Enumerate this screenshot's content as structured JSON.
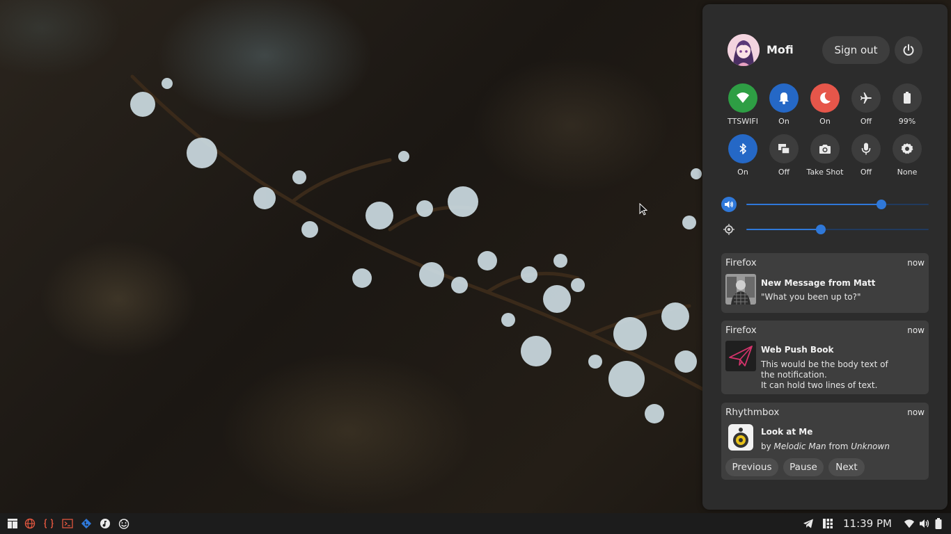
{
  "user": {
    "name": "Mofi"
  },
  "session": {
    "signout_label": "Sign out"
  },
  "toggles_row1": [
    {
      "icon": "wifi-icon",
      "label": "TTSWIFI",
      "color": "#2e9e44"
    },
    {
      "icon": "bell-icon",
      "label": "On",
      "color": "#2568c6"
    },
    {
      "icon": "moon-icon",
      "label": "On",
      "color": "#e6564a"
    },
    {
      "icon": "airplane-icon",
      "label": "Off",
      "color": "#3d3d3d"
    },
    {
      "icon": "battery-icon",
      "label": "99%",
      "color": "#3d3d3d"
    }
  ],
  "toggles_row2": [
    {
      "icon": "bluetooth-icon",
      "label": "On",
      "color": "#2568c6"
    },
    {
      "icon": "display-icon",
      "label": "Off",
      "color": "#3d3d3d"
    },
    {
      "icon": "camera-icon",
      "label": "Take Shot",
      "color": "#3d3d3d"
    },
    {
      "icon": "microphone-icon",
      "label": "Off",
      "color": "#3d3d3d"
    },
    {
      "icon": "settings-icon",
      "label": "None",
      "color": "#3d3d3d"
    }
  ],
  "volume": {
    "level": 0.74
  },
  "brightness": {
    "level": 0.41
  },
  "notifications": [
    {
      "app": "Firefox",
      "time": "now",
      "title": "New Message from Matt",
      "body": "\"What you been up to?\""
    },
    {
      "app": "Firefox",
      "time": "now",
      "title": "Web Push Book",
      "body_lines": [
        "This would be the body text of",
        "the notification.",
        "It can hold two lines of text."
      ]
    },
    {
      "app": "Rhythmbox",
      "time": "now",
      "title": "Look at Me",
      "by": "by",
      "artist": "Melodic Man",
      "from": "from",
      "album": "Unknown",
      "buttons": {
        "previous": "Previous",
        "pause": "Pause",
        "next": "Next"
      }
    }
  ],
  "taskbar": {
    "clock": "11:39 PM"
  },
  "colors": {
    "accent": "#2f78d9",
    "panel": "#2c2c2c",
    "notification": "#3e3e3e"
  }
}
